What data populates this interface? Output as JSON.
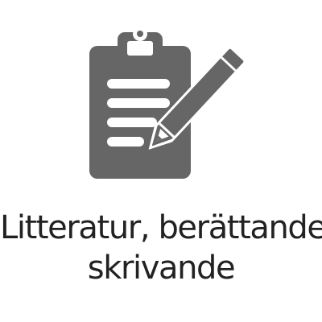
{
  "tile": {
    "icon": "clipboard-pen-icon",
    "icon_color": "#666666",
    "text_color": "#222222",
    "label_line1": "Litteratur, berättande,",
    "label_line2": "skrivande"
  }
}
